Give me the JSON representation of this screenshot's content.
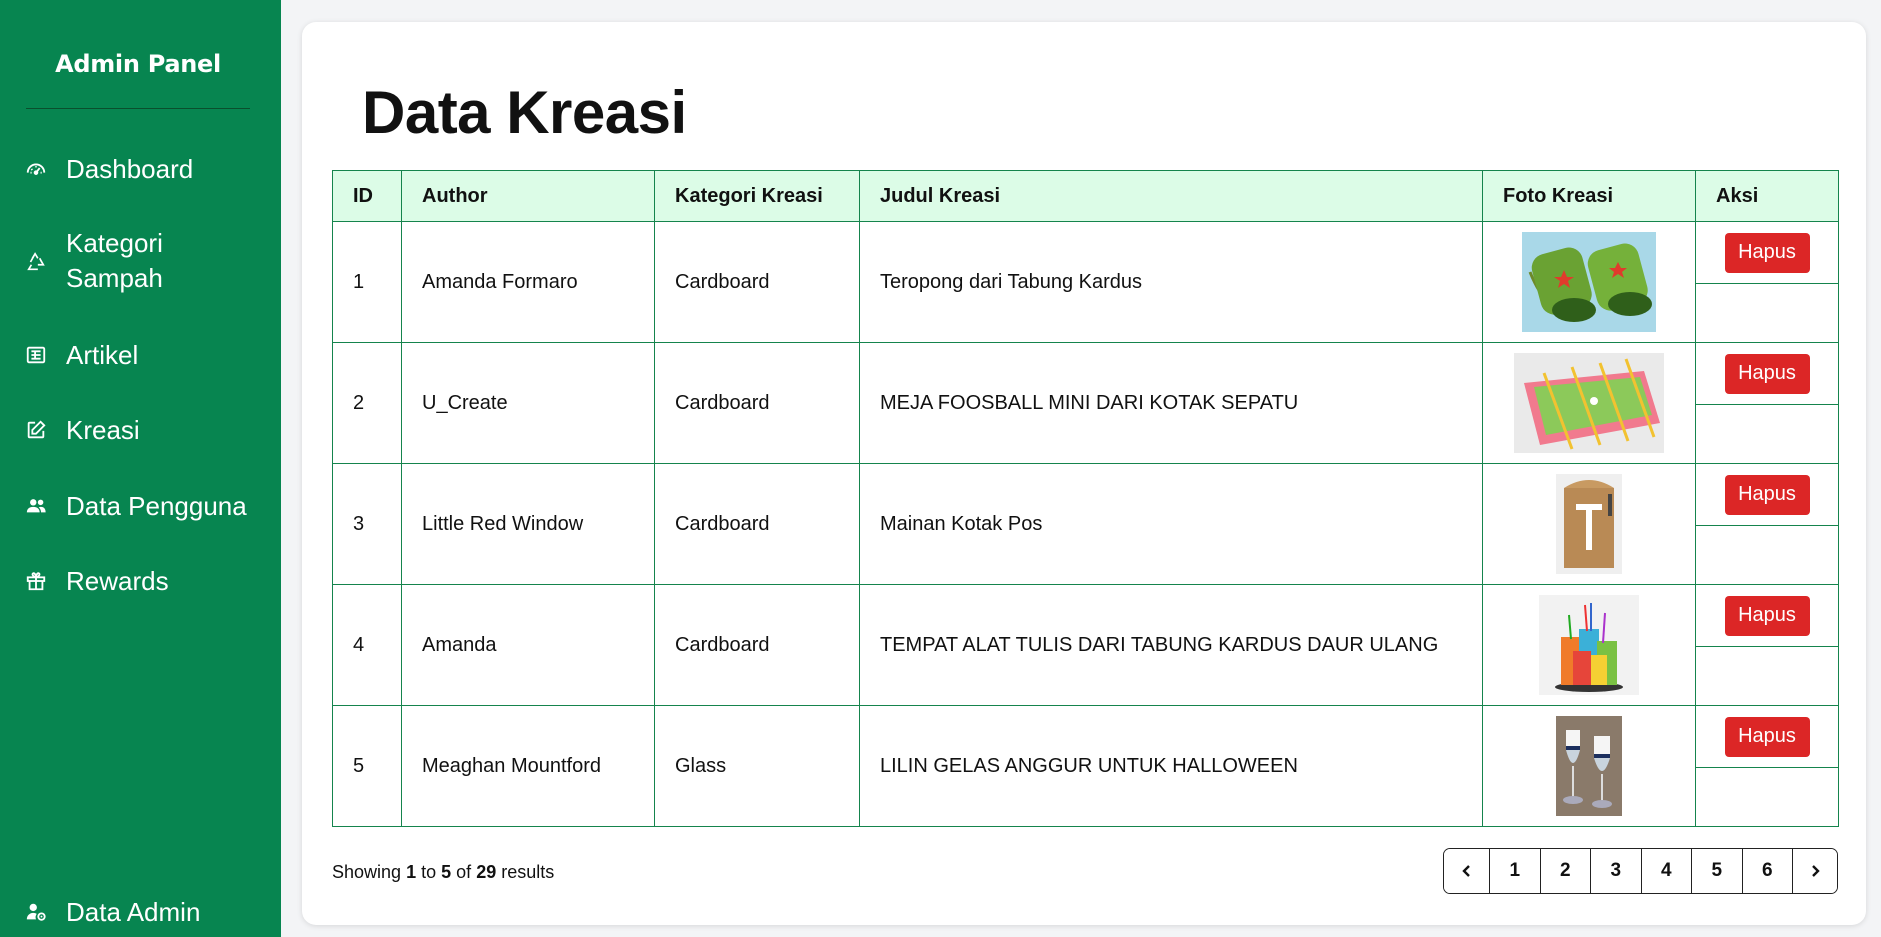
{
  "sidebar": {
    "brand": "Admin Panel",
    "items": [
      {
        "label": "Dashboard",
        "icon": "gauge-icon"
      },
      {
        "label": "Kategori",
        "label2": "Sampah",
        "icon": "recycle-icon"
      },
      {
        "label": "Artikel",
        "icon": "newspaper-icon"
      },
      {
        "label": "Kreasi",
        "icon": "edit-icon"
      },
      {
        "label": "Data Pengguna",
        "icon": "users-icon"
      },
      {
        "label": "Rewards",
        "icon": "gift-icon"
      }
    ],
    "footer": {
      "label": "Data Admin",
      "icon": "user-gear-icon"
    }
  },
  "main": {
    "title": "Data Kreasi",
    "table": {
      "headers": [
        "ID",
        "Author",
        "Kategori Kreasi",
        "Judul Kreasi",
        "Foto Kreasi",
        "Aksi"
      ],
      "rows": [
        {
          "id": "1",
          "author": "Amanda Formaro",
          "kategori": "Cardboard",
          "judul": "Teropong dari Tabung Kardus",
          "photo": "binoculars-photo",
          "action": "Hapus"
        },
        {
          "id": "2",
          "author": "U_Create",
          "kategori": "Cardboard",
          "judul": "MEJA FOOSBALL MINI DARI KOTAK SEPATU",
          "photo": "foosball-photo",
          "action": "Hapus"
        },
        {
          "id": "3",
          "author": "Little Red Window",
          "kategori": "Cardboard",
          "judul": "Mainan Kotak Pos",
          "photo": "mailbox-photo",
          "action": "Hapus"
        },
        {
          "id": "4",
          "author": "Amanda",
          "kategori": "Cardboard",
          "judul": "TEMPAT ALAT TULIS DARI TABUNG KARDUS DAUR ULANG",
          "photo": "pencil-holder-photo",
          "action": "Hapus"
        },
        {
          "id": "5",
          "author": "Meaghan Mountford",
          "kategori": "Glass",
          "judul": "LILIN GELAS ANGGUR UNTUK HALLOWEEN",
          "photo": "wine-glass-candles-photo",
          "action": "Hapus"
        }
      ]
    },
    "pagination": {
      "showing_prefix": "Showing",
      "from": "1",
      "to_word": "to",
      "to": "5",
      "of_word": "of",
      "total": "29",
      "suffix": "results",
      "pages": [
        "1",
        "2",
        "3",
        "4",
        "5",
        "6"
      ],
      "prev_icon": "chevron-left-icon",
      "next_icon": "chevron-right-icon"
    }
  },
  "colors": {
    "sidebar_bg": "#078550",
    "header_bg": "#dcfce7",
    "border": "#15844d",
    "danger": "#dc2626"
  }
}
